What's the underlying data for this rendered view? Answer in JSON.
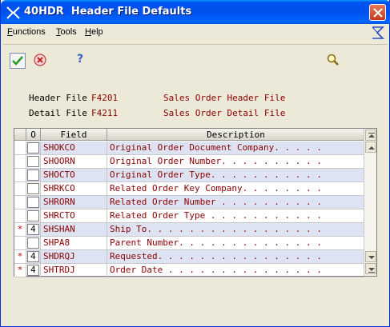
{
  "window": {
    "app_code": "40HDR",
    "title": "Header File Defaults"
  },
  "menubar": {
    "items": [
      {
        "underline": "F",
        "rest": "unctions"
      },
      {
        "underline": "T",
        "rest": "ools"
      },
      {
        "underline": "H",
        "rest": "elp"
      }
    ]
  },
  "toolbar": {
    "ok_icon": "check-icon",
    "cancel_icon": "cancel-icon",
    "help_label": "?",
    "search_icon": "magnifier-icon"
  },
  "form": {
    "header_label": "Header File",
    "header_value": "F4201",
    "header_desc": "Sales Order Header File",
    "detail_label": "Detail File",
    "detail_value": "F4211",
    "detail_desc": "Sales Order Detail File"
  },
  "grid": {
    "columns": [
      "O",
      "Field",
      "Description"
    ],
    "rows": [
      {
        "mark": "",
        "o": "",
        "field": "SHOKCO",
        "desc": "Original Order Document Company. . . . ."
      },
      {
        "mark": "",
        "o": "",
        "field": "SHOORN",
        "desc": "Original Order Number. . . . . . . . . ."
      },
      {
        "mark": "",
        "o": "",
        "field": "SHOCTO",
        "desc": "Original Order Type. . . . . . . . . . ."
      },
      {
        "mark": "",
        "o": "",
        "field": "SHRKCO",
        "desc": "Related Order Key Company. . . . . . . ."
      },
      {
        "mark": "",
        "o": "",
        "field": "SHRORN",
        "desc": "Related Order Number . . . . . . . . . ."
      },
      {
        "mark": "",
        "o": "",
        "field": "SHRCTO",
        "desc": "Related Order Type . . . . . . . . . . ."
      },
      {
        "mark": "*",
        "o": "4",
        "field": "SHSHAN",
        "desc": "Ship To. . . . . . . . . . . . . . . . ."
      },
      {
        "mark": "",
        "o": "",
        "field": "SHPA8",
        "desc": "Parent Number. . . . . . . . . . . . . ."
      },
      {
        "mark": "*",
        "o": "4",
        "field": "SHDRQJ",
        "desc": "Requested. . . . . . . . . . . . . . . ."
      },
      {
        "mark": "*",
        "o": "4",
        "field": "SHTRDJ",
        "desc": "Order Date . . . . . . . . . . . . . . ."
      }
    ]
  },
  "colors": {
    "title_bar": "#0053ee",
    "field_text": "#8b0000",
    "row_alt": "#dde3f2",
    "mark": "#c00000"
  }
}
